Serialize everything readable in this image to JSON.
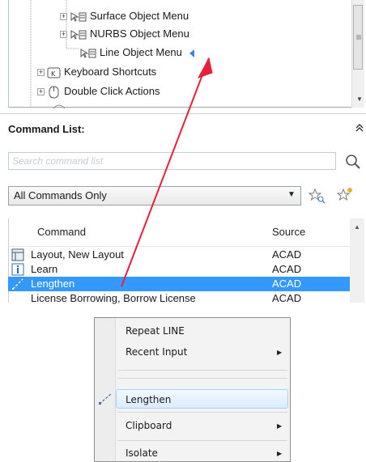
{
  "tree": {
    "items": [
      {
        "label": "Surface Object Menu"
      },
      {
        "label": "NURBS Object Menu"
      },
      {
        "label": "Line Object Menu"
      },
      {
        "label": "Keyboard Shortcuts"
      },
      {
        "label": "Double Click Actions"
      }
    ]
  },
  "command_list": {
    "title": "Command List:",
    "search_placeholder": "Search command list",
    "filter_value": "All Commands Only",
    "columns": {
      "command": "Command",
      "source": "Source"
    },
    "rows": [
      {
        "command": "Layout, New Layout",
        "source": "ACAD",
        "icon": "layout-icon"
      },
      {
        "command": "Learn",
        "source": "ACAD",
        "icon": "info-icon"
      },
      {
        "command": "Lengthen",
        "source": "ACAD",
        "icon": "lengthen-icon",
        "selected": true
      },
      {
        "command": "License Borrowing, Borrow License",
        "source": "ACAD",
        "icon": ""
      }
    ]
  },
  "context_menu": {
    "items": [
      {
        "label": "Repeat LINE",
        "submenu": false
      },
      {
        "label": "Recent Input",
        "submenu": true
      },
      {
        "label": "Lengthen",
        "submenu": false,
        "highlighted": true,
        "icon": "lengthen-icon"
      },
      {
        "label": "Clipboard",
        "submenu": true
      },
      {
        "label": "Isolate",
        "submenu": true
      }
    ]
  },
  "colors": {
    "selection": "#3399ff",
    "annotation_arrow": "#e8203a",
    "tree_marker": "#3b87d6"
  }
}
